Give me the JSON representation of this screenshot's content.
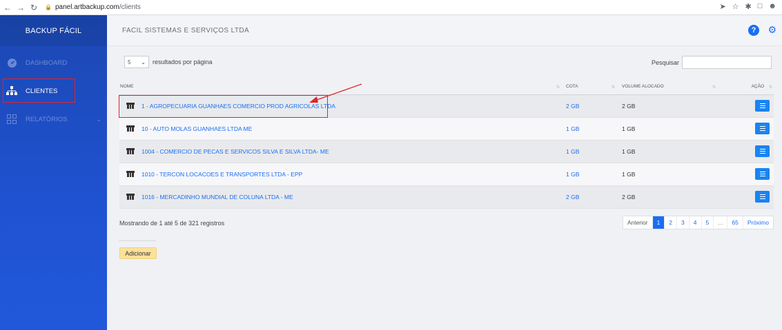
{
  "browser": {
    "url_domain": "panel.artbackup.com",
    "url_path": "/clients"
  },
  "sidebar": {
    "brand": "BACKUP FÁCIL",
    "items": [
      {
        "label": "DASHBOARD",
        "icon": "dashboard-gauge-icon"
      },
      {
        "label": "CLIENTES",
        "icon": "sitemap-icon"
      },
      {
        "label": "RELATÓRIOS",
        "icon": "grid-icon"
      }
    ]
  },
  "header": {
    "company": "FACIL SISTEMAS E SERVIÇOS LTDA"
  },
  "controls": {
    "page_length": "5",
    "page_length_suffix": "resultados por página",
    "search_label": "Pesquisar"
  },
  "table": {
    "columns": [
      "NOME",
      "COTA",
      "VOLUME ALOCADO",
      "AÇÃO"
    ],
    "rows": [
      {
        "name": "1 - AGROPECUARIA GUANHAES COMERCIO PROD AGRICOLAS LTDA",
        "quota": "2 GB",
        "volume": "2 GB"
      },
      {
        "name": "10 - AUTO MOLAS GUANHAES LTDA ME",
        "quota": "1 GB",
        "volume": "1 GB"
      },
      {
        "name": "1004 - COMERCIO DE PECAS E SERVICOS SILVA E SILVA LTDA- ME",
        "quota": "1 GB",
        "volume": "1 GB"
      },
      {
        "name": "1010 - TERCON LOCACOES E TRANSPORTES LTDA - EPP",
        "quota": "1 GB",
        "volume": "1 GB"
      },
      {
        "name": "1016 - MERCADINHO MUNDIAL DE COLUNA LTDA - ME",
        "quota": "2 GB",
        "volume": "2 GB"
      }
    ]
  },
  "footer": {
    "info": "Mostrando de 1 até 5 de 321 registros",
    "pager": {
      "prev": "Anterior",
      "pages": [
        "1",
        "2",
        "3",
        "4",
        "5",
        "...",
        "65"
      ],
      "next": "Próximo"
    },
    "add_label": "Adicionar"
  },
  "colors": {
    "accent": "#1a6ef2",
    "highlight": "#e0242c",
    "add_button": "#fbe19b"
  }
}
